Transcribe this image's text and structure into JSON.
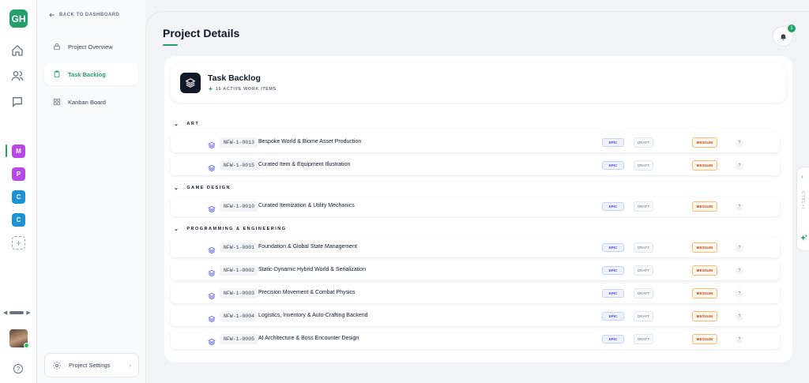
{
  "app": {
    "logo": "GH"
  },
  "rail": {
    "icons": [
      "home-icon",
      "users-icon",
      "chat-icon"
    ],
    "workspaces": [
      {
        "label": "M",
        "color": "#b947e8"
      },
      {
        "label": "P",
        "color": "#b947e8"
      },
      {
        "label": "C",
        "color": "#1a94d6"
      },
      {
        "label": "C",
        "color": "#1a94d6"
      }
    ],
    "add": "+",
    "scroll_left": "◀",
    "scroll_right": "▶",
    "help": "?"
  },
  "nav": {
    "back": "BACK TO DASHBOARD",
    "items": [
      {
        "label": "Project Overview",
        "icon": "lock-icon",
        "active": false
      },
      {
        "label": "Task Backlog",
        "icon": "clipboard-icon",
        "active": true
      },
      {
        "label": "Kanban Board",
        "icon": "grid-icon",
        "active": false
      }
    ],
    "settings": "Project Settings"
  },
  "header": {
    "title": "Project Details",
    "notifications": "1"
  },
  "backlog": {
    "title": "Task Backlog",
    "subtitle": "16 ACTIVE WORK ITEMS",
    "groups": [
      {
        "name": "ART",
        "tasks": [
          {
            "id": "NFW-1-0013",
            "name": "Bespoke World & Biome Asset Production"
          },
          {
            "id": "NFW-1-0015",
            "name": "Curated Item & Equipment Illustration"
          }
        ]
      },
      {
        "name": "GAME DESIGN",
        "tasks": [
          {
            "id": "NFW-1-0010",
            "name": "Curated Itemization & Utility Mechanics"
          }
        ]
      },
      {
        "name": "PROGRAMMING & ENGINEERING",
        "tasks": [
          {
            "id": "NFW-1-0001",
            "name": "Foundation & Global State Management"
          },
          {
            "id": "NFW-1-0002",
            "name": "Static-Dynamic Hybrid World & Serialization"
          },
          {
            "id": "NFW-1-0003",
            "name": "Precision Movement & Combat Physics"
          },
          {
            "id": "NFW-1-0004",
            "name": "Logistics, Inventory & Auto-Crafting Backend"
          },
          {
            "id": "NFW-1-0005",
            "name": "AI Architecture & Boss Encounter Design"
          }
        ]
      }
    ],
    "type_label": "EPIC",
    "status_label": "DRAFT",
    "priority_label": "MEDIUM",
    "unknown_label": "?"
  },
  "side_panel": {
    "label": "CTRL+I"
  },
  "colors": {
    "accent": "#22a06b",
    "epic": "#4f46e5",
    "priority": "#c2410c"
  }
}
